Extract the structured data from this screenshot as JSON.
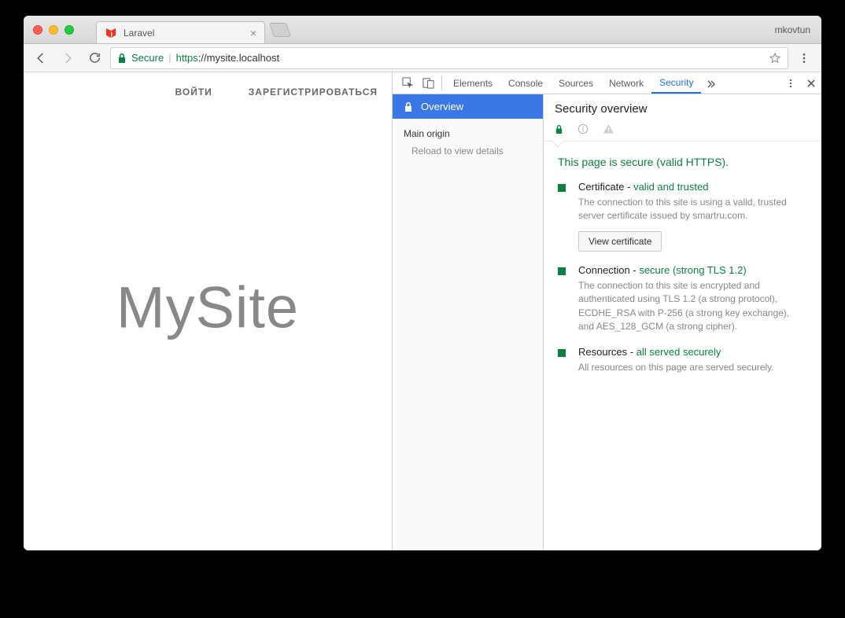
{
  "window": {
    "profile": "mkovtun"
  },
  "tab": {
    "title": "Laravel"
  },
  "toolbar": {
    "secure_chip": "Secure",
    "url_scheme": "https",
    "url_rest": "://mysite.localhost"
  },
  "page": {
    "nav": {
      "login": "ВОЙТИ",
      "register": "ЗАРЕГИСТРИРОВАТЬСЯ"
    },
    "hero": "MySite"
  },
  "devtools": {
    "tabs": {
      "elements": "Elements",
      "console": "Console",
      "sources": "Sources",
      "network": "Network",
      "security": "Security"
    },
    "sidebar": {
      "overview": "Overview",
      "main_origin": "Main origin",
      "reload_hint": "Reload to view details"
    },
    "main": {
      "heading": "Security overview",
      "secure_line": "This page is secure (valid HTTPS).",
      "cert": {
        "title_prefix": "Certificate - ",
        "title_status": "valid and trusted",
        "desc": "The connection to this site is using a valid, trusted server certificate issued by smartru.com.",
        "button": "View certificate"
      },
      "conn": {
        "title_prefix": "Connection - ",
        "title_status": "secure (strong TLS 1.2)",
        "desc": "The connection to this site is encrypted and authenticated using TLS 1.2 (a strong protocol), ECDHE_RSA with P-256 (a strong key exchange), and AES_128_GCM (a strong cipher)."
      },
      "res": {
        "title_prefix": "Resources - ",
        "title_status": "all served securely",
        "desc": "All resources on this page are served securely."
      }
    }
  }
}
